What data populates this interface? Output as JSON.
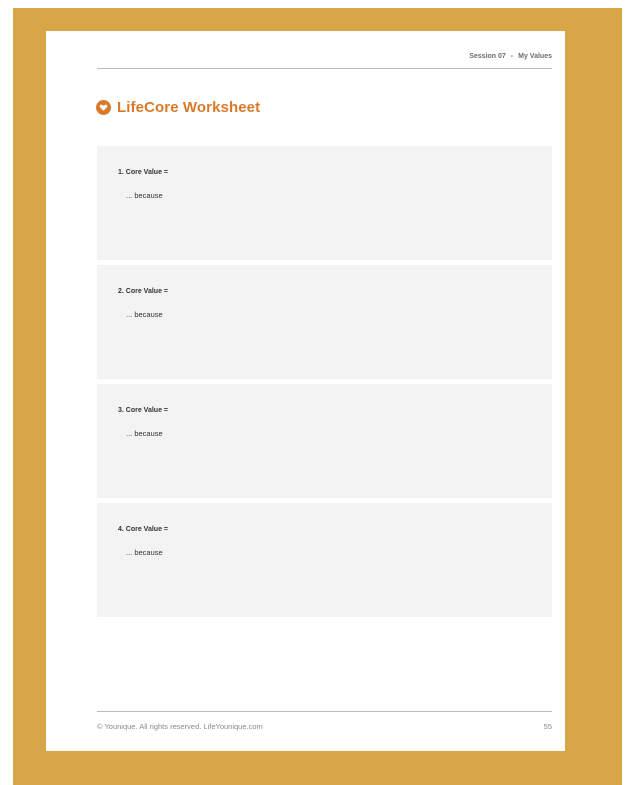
{
  "header": {
    "session": "Session 07",
    "separator": "-",
    "section": "My Values"
  },
  "title": {
    "icon": "heart-circle-icon",
    "text": "LifeCore Worksheet",
    "color": "#d97a2b"
  },
  "values": [
    {
      "label": "1. Core Value =",
      "because": "... because"
    },
    {
      "label": "2. Core Value =",
      "because": "... because"
    },
    {
      "label": "3. Core Value =",
      "because": "... because"
    },
    {
      "label": "4. Core Value =",
      "because": "... because"
    }
  ],
  "footer": {
    "copyright": "© Younique. All rights reserved. LifeYounique.com",
    "page_number": "55"
  },
  "colors": {
    "frame": "#d8a647",
    "box": "#f2f3f2",
    "accent": "#d97a2b"
  }
}
